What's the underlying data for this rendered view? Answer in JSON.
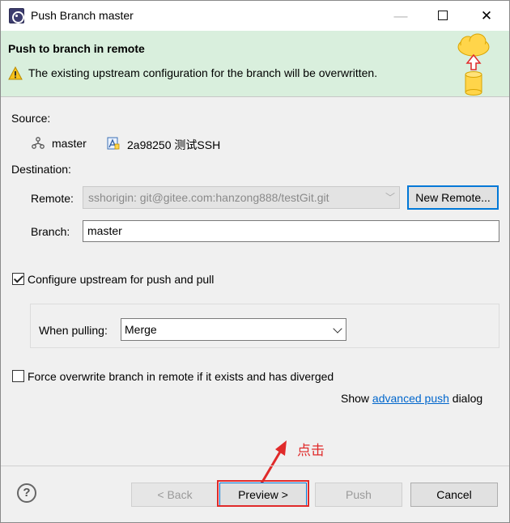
{
  "window": {
    "title": "Push Branch master",
    "minimize_glyph": "—",
    "close_glyph": "✕"
  },
  "banner": {
    "title": "Push to branch in remote",
    "message": "The existing upstream configuration for the branch will be overwritten."
  },
  "source": {
    "label": "Source:",
    "branch": "master",
    "commit": "2a98250 测试SSH"
  },
  "destination": {
    "label": "Destination:",
    "remote_label": "Remote:",
    "remote_value": "sshorigin: git@gitee.com:hanzong888/testGit.git",
    "new_remote_button": "New Remote...",
    "branch_label": "Branch:",
    "branch_value": "master"
  },
  "options": {
    "configure_upstream_label": "Configure upstream for push and pull",
    "configure_upstream_checked": true,
    "when_pulling_label": "When pulling:",
    "when_pulling_value": "Merge",
    "force_overwrite_label": "Force overwrite branch in remote if it exists and has diverged",
    "force_overwrite_checked": false,
    "show_prefix": "Show",
    "advanced_push_link": "advanced push",
    "show_suffix": "dialog"
  },
  "buttons": {
    "help": "?",
    "back": "< Back",
    "preview": "Preview >",
    "push": "Push",
    "cancel": "Cancel"
  },
  "annotation": {
    "text": "点击",
    "color": "#e02a2a"
  },
  "colors": {
    "banner_bg": "#d9efdd",
    "accent": "#0078d7",
    "link": "#0066cc"
  }
}
